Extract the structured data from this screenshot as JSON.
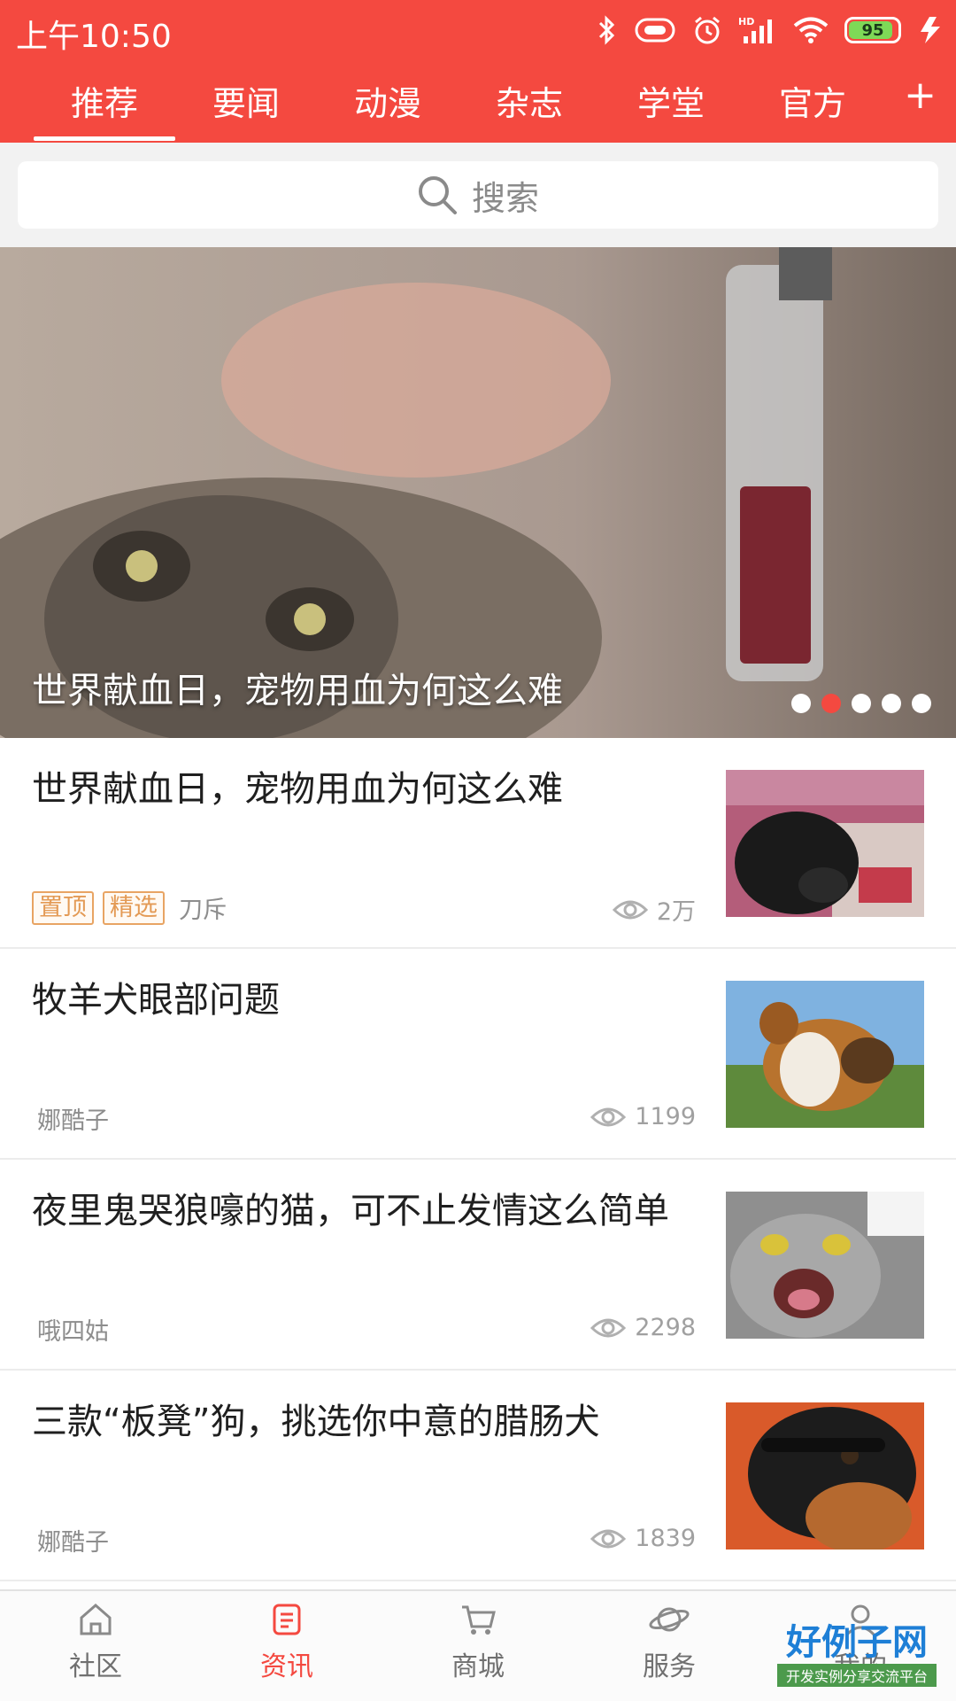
{
  "status_bar": {
    "time": "上午10:50",
    "battery_level": "95",
    "battery_fraction": 0.95,
    "icons": [
      "bluetooth-icon",
      "vibrate-icon",
      "alarm-icon",
      "hd-signal-icon",
      "wifi-icon",
      "battery-icon",
      "charging-icon"
    ]
  },
  "colors": {
    "brand": "#f44940",
    "tag_orange": "#e39a55",
    "watermark_blue": "#1e7fd6"
  },
  "tabs": [
    {
      "label": "推荐",
      "active": true
    },
    {
      "label": "要闻"
    },
    {
      "label": "动漫"
    },
    {
      "label": "杂志"
    },
    {
      "label": "学堂"
    },
    {
      "label": "官方"
    }
  ],
  "tabs_add_label": "+",
  "search": {
    "placeholder": "搜索"
  },
  "banner": {
    "title": "世界献血日，宠物用血为何这么难",
    "slide_count": 5,
    "active_index": 1
  },
  "news": [
    {
      "title": "世界献血日，宠物用血为何这么难",
      "tags": [
        "置顶",
        "精选"
      ],
      "author": "刀斥",
      "views": "2万",
      "thumb": "black-dog-photo"
    },
    {
      "title": "牧羊犬眼部问题",
      "tags": [],
      "author": "娜酷子",
      "views": "1199",
      "thumb": "collie-photo"
    },
    {
      "title": "夜里鬼哭狼嚎的猫，可不止发情这么简单",
      "tags": [],
      "author": "哦四姑",
      "views": "2298",
      "thumb": "screaming-cat-photo"
    },
    {
      "title": "三款“板凳”狗，挑选你中意的腊肠犬",
      "tags": [],
      "author": "娜酷子",
      "views": "1839",
      "thumb": "dachshund-photo"
    }
  ],
  "bottom_nav": [
    {
      "label": "社区",
      "icon": "home-icon"
    },
    {
      "label": "资讯",
      "icon": "news-icon",
      "active": true
    },
    {
      "label": "商城",
      "icon": "cart-icon"
    },
    {
      "label": "服务",
      "icon": "planet-icon"
    },
    {
      "label": "我的",
      "icon": "profile-icon"
    }
  ],
  "watermark": {
    "brand": "好例子网",
    "sub": "开发实例分享交流平台"
  }
}
